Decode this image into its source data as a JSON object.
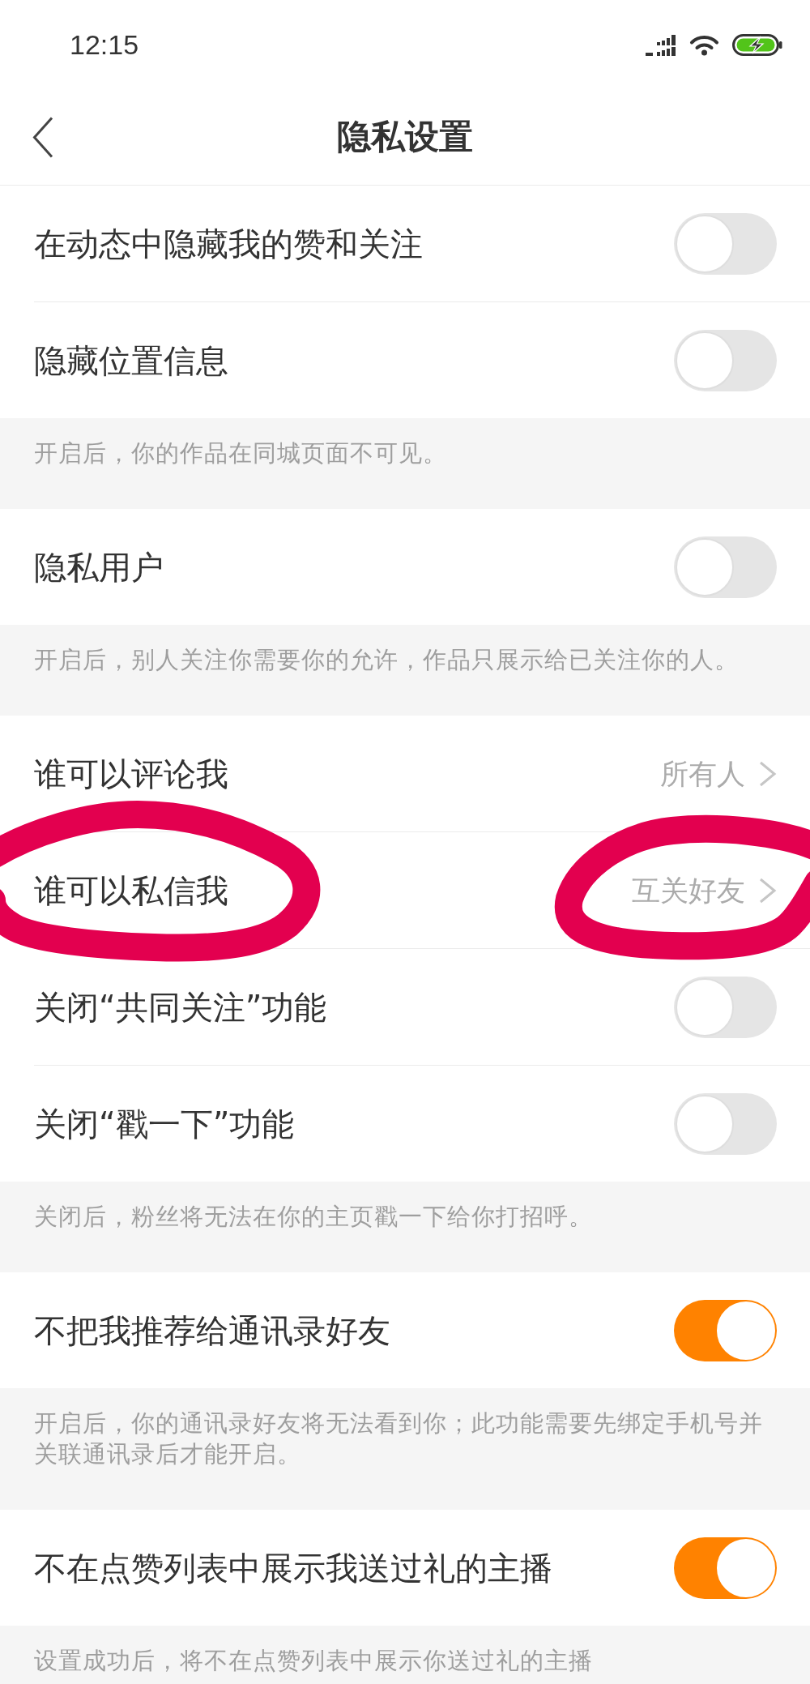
{
  "status_bar": {
    "time": "12:15"
  },
  "header": {
    "title": "隐私设置"
  },
  "sections": [
    {
      "rows": [
        {
          "kind": "toggle",
          "label": "在动态中隐藏我的赞和关注",
          "on": false
        },
        {
          "kind": "toggle",
          "label": "隐藏位置信息",
          "on": false
        }
      ],
      "note": "开启后，你的作品在同城页面不可见。"
    },
    {
      "rows": [
        {
          "kind": "toggle",
          "label": "隐私用户",
          "on": false
        }
      ],
      "note": "开启后，别人关注你需要你的允许，作品只展示给已关注你的人。"
    },
    {
      "rows": [
        {
          "kind": "link",
          "label": "谁可以评论我",
          "value": "所有人"
        },
        {
          "kind": "link",
          "label": "谁可以私信我",
          "value": "互关好友",
          "circled": true
        },
        {
          "kind": "toggle",
          "label": "关闭“共同关注”功能",
          "on": false
        },
        {
          "kind": "toggle",
          "label": "关闭“戳一下”功能",
          "on": false
        }
      ],
      "note": "关闭后，粉丝将无法在你的主页戳一下给你打招呼。"
    },
    {
      "rows": [
        {
          "kind": "toggle",
          "label": "不把我推荐给通讯录好友",
          "on": true
        }
      ],
      "note": "开启后，你的通讯录好友将无法看到你；此功能需要先绑定手机号并关联通讯录后才能开启。"
    },
    {
      "rows": [
        {
          "kind": "toggle",
          "label": "不在点赞列表中展示我送过礼的主播",
          "on": true
        }
      ],
      "note": "设置成功后，将不在点赞列表中展示你送过礼的主播"
    }
  ]
}
